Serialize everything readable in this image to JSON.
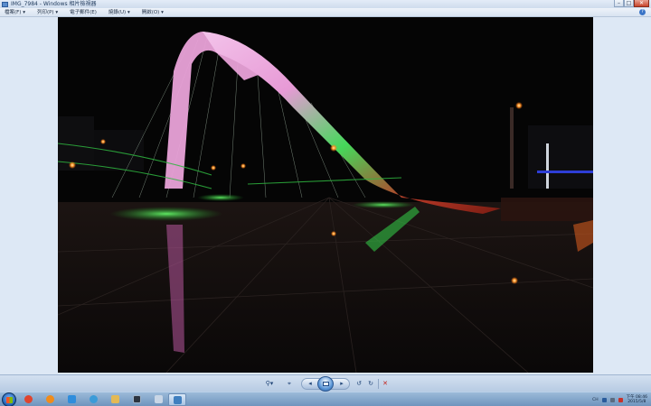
{
  "window": {
    "title": "IMG_7984 - Windows 相片檢視器",
    "buttons": {
      "minimize": "–",
      "maximize": "□",
      "close": "✕"
    }
  },
  "menu": {
    "items": [
      {
        "label": "檔案(F) ▾"
      },
      {
        "label": "列印(P) ▾"
      },
      {
        "label": "電子郵件(E)"
      },
      {
        "label": "燒錄(U) ▾"
      },
      {
        "label": "開啟(O) ▾"
      }
    ],
    "help": "?"
  },
  "photo": {
    "icon": "photo-image",
    "colors": {
      "sky": "#050505",
      "arch_pink": "#e9a2d8",
      "arch_green": "#35d64a",
      "deck_red": "#c0341e",
      "lights": "#ff9a3a"
    }
  },
  "controls": {
    "zoom": "⚲▾",
    "fit": "⌖",
    "prev": "◂",
    "slideshow_icon": "slideshow-icon",
    "next": "▸",
    "rotate_left": "↺",
    "rotate_right": "↻",
    "delete": "✕"
  },
  "taskbar": {
    "apps": [
      {
        "name": "chrome",
        "color": "#e0442e"
      },
      {
        "name": "media-player",
        "color": "#f08c1b"
      },
      {
        "name": "photo-gallery",
        "color": "#2f8ddc"
      },
      {
        "name": "ie",
        "color": "#3b9bd8"
      },
      {
        "name": "explorer",
        "color": "#e3b955"
      },
      {
        "name": "lightroom",
        "color": "#2c3440"
      },
      {
        "name": "paint",
        "color": "#c9d6e6"
      },
      {
        "name": "photo-viewer",
        "color": "#3f7fbf"
      }
    ],
    "tray": {
      "lang": "CH",
      "time": "下午 08:46",
      "date": "2015/5/8"
    }
  }
}
